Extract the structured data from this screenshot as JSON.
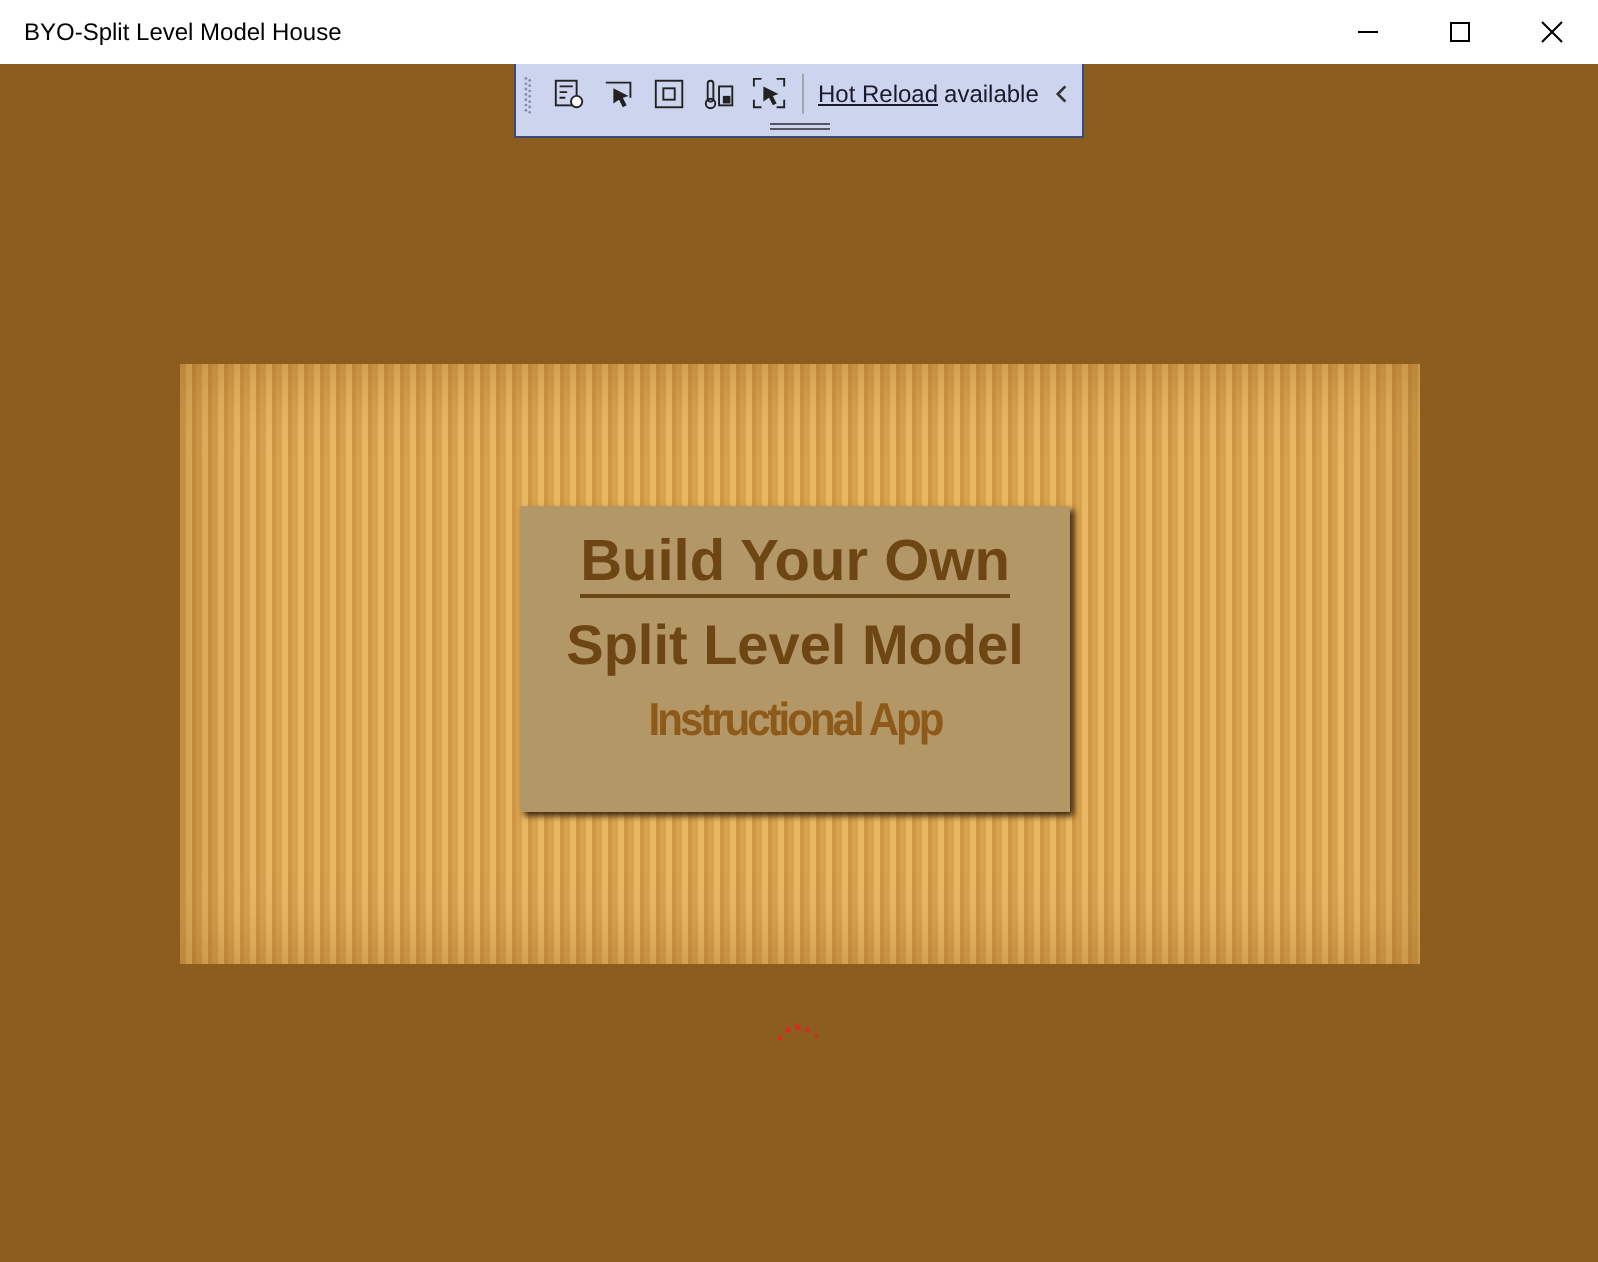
{
  "window": {
    "title": "BYO-Split Level Model House"
  },
  "toolbar": {
    "link": "Hot Reload",
    "status": "available"
  },
  "splash": {
    "heading": "Build Your Own",
    "subheading": "Split Level Model",
    "tagline": "Instructional App"
  }
}
